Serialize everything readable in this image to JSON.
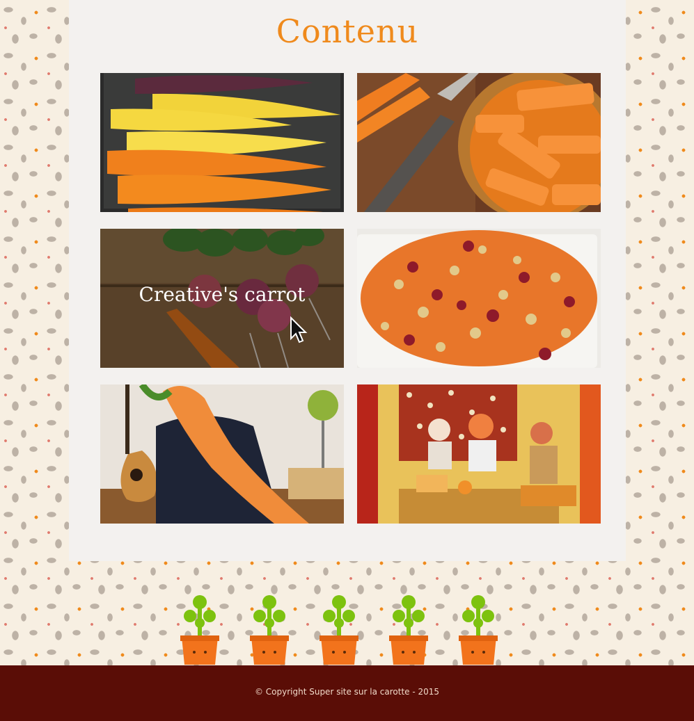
{
  "page": {
    "title": "Contenu",
    "accent_color": "#ef8a1c"
  },
  "gallery": {
    "tiles": [
      {
        "subject": "rainbow carrots on tray",
        "icon": "carrots-photo"
      },
      {
        "subject": "sliced carrots with knife",
        "icon": "sliced-carrots-photo"
      },
      {
        "subject": "radishes and carrot",
        "icon": "radish-photo",
        "hover_caption": "Creative's carrot"
      },
      {
        "subject": "carrot salad with pomegranate",
        "icon": "salad-photo"
      },
      {
        "subject": "plush carrot on armchair",
        "icon": "plush-carrot-photo"
      },
      {
        "subject": "paper doll tea party",
        "icon": "paper-dolls-photo"
      }
    ]
  },
  "decor": {
    "pot_count": 5,
    "pot_icon": "carrot-pot-icon"
  },
  "footer": {
    "copyright": "© Copyright Super site sur la carotte - 2015",
    "background": "#5a0d06"
  }
}
